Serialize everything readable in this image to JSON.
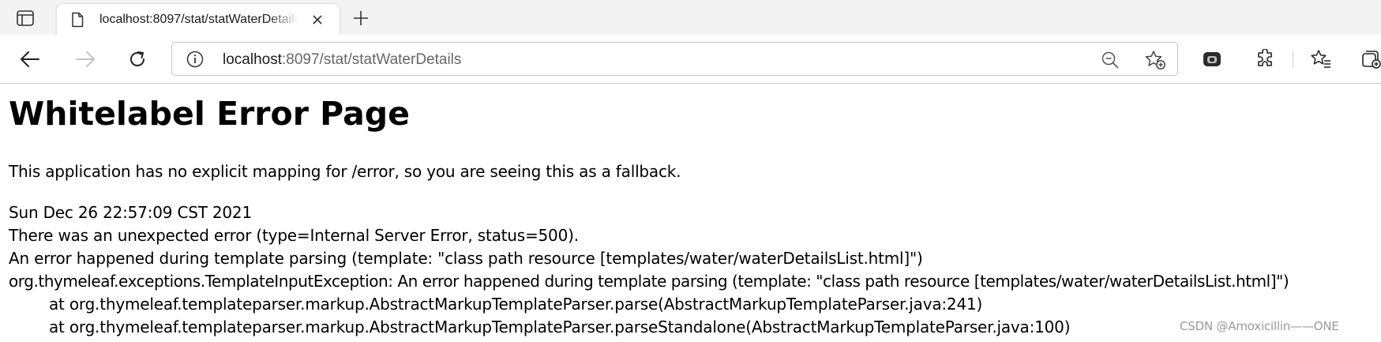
{
  "browser": {
    "tab": {
      "title": "localhost:8097/stat/statWaterDetails",
      "favicon": "page-icon",
      "close_icon": "close-icon"
    },
    "new_tab_icon": "plus-icon",
    "nav": {
      "back_icon": "back-arrow-icon",
      "forward_icon": "forward-arrow-icon",
      "refresh_icon": "refresh-icon"
    },
    "address": {
      "host": "localhost",
      "port": ":8097",
      "path": "/stat/statWaterDetails",
      "info_icon": "info-icon",
      "zoom_icon": "zoom-out-icon",
      "favorite_icon": "add-favorite-icon"
    },
    "toolbar_icons": [
      "copilot-icon",
      "extensions-icon",
      "favorites-icon",
      "collections-icon"
    ]
  },
  "page": {
    "title": "Whitelabel Error Page",
    "intro": "This application has no explicit mapping for /error, so you are seeing this as a fallback.",
    "timestamp": "Sun Dec 26 22:57:09 CST 2021",
    "status_line": "There was an unexpected error (type=Internal Server Error, status=500).",
    "message": "An error happened during template parsing (template: \"class path resource [templates/water/waterDetailsList.html]\")",
    "exception": "org.thymeleaf.exceptions.TemplateInputException: An error happened during template parsing (template: \"class path resource [templates/water/waterDetailsList.html]\")",
    "stack": [
      "at org.thymeleaf.templateparser.markup.AbstractMarkupTemplateParser.parse(AbstractMarkupTemplateParser.java:241)",
      "at org.thymeleaf.templateparser.markup.AbstractMarkupTemplateParser.parseStandalone(AbstractMarkupTemplateParser.java:100)"
    ]
  },
  "watermark": "CSDN @Amoxicillin——ONE",
  "colors": {
    "tabstrip": "#f3f3f3",
    "icon": "#333333",
    "url_dim": "#666666",
    "watermark": "#9a9a9a"
  }
}
